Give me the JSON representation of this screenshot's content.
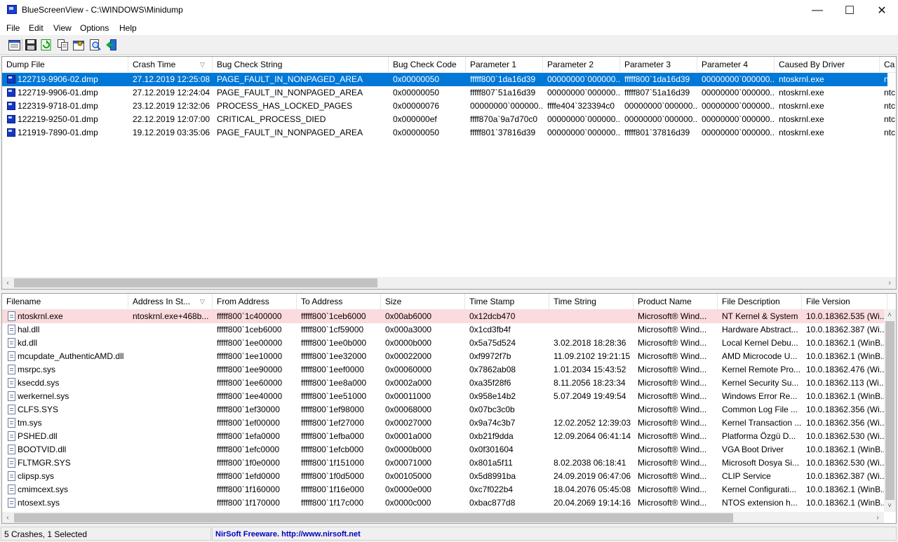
{
  "window": {
    "title": "BlueScreenView  -  C:\\WINDOWS\\Minidump",
    "minimize": "—",
    "maximize": "☐",
    "close": "✕"
  },
  "menu": [
    "File",
    "Edit",
    "View",
    "Options",
    "Help"
  ],
  "toolbar_icons": [
    "properties-icon",
    "save-icon",
    "refresh-icon",
    "copy-icon",
    "advanced-options-icon",
    "find-icon",
    "exit-icon"
  ],
  "crashes": {
    "columns": [
      "Dump File",
      "Crash Time",
      "Bug Check String",
      "Bug Check Code",
      "Parameter 1",
      "Parameter 2",
      "Parameter 3",
      "Parameter 4",
      "Caused By Driver",
      "Ca"
    ],
    "sorted_column": "Crash Time",
    "rows": [
      [
        "122719-9906-02.dmp",
        "27.12.2019 12:25:08",
        "PAGE_FAULT_IN_NONPAGED_AREA",
        "0x00000050",
        "fffff800`1da16d39",
        "00000000`000000...",
        "fffff800`1da16d39",
        "00000000`000000...",
        "ntoskrnl.exe",
        "ntc"
      ],
      [
        "122719-9906-01.dmp",
        "27.12.2019 12:24:04",
        "PAGE_FAULT_IN_NONPAGED_AREA",
        "0x00000050",
        "fffff807`51a16d39",
        "00000000`000000...",
        "fffff807`51a16d39",
        "00000000`000000...",
        "ntoskrnl.exe",
        "ntc"
      ],
      [
        "122319-9718-01.dmp",
        "23.12.2019 12:32:06",
        "PROCESS_HAS_LOCKED_PAGES",
        "0x00000076",
        "00000000`000000...",
        "ffffe404`323394c0",
        "00000000`000000...",
        "00000000`000000...",
        "ntoskrnl.exe",
        "ntc"
      ],
      [
        "122219-9250-01.dmp",
        "22.12.2019 12:07:00",
        "CRITICAL_PROCESS_DIED",
        "0x000000ef",
        "ffff870a`9a7d70c0",
        "00000000`000000...",
        "00000000`000000...",
        "00000000`000000...",
        "ntoskrnl.exe",
        "ntc"
      ],
      [
        "121919-7890-01.dmp",
        "19.12.2019 03:35:06",
        "PAGE_FAULT_IN_NONPAGED_AREA",
        "0x00000050",
        "fffff801`37816d39",
        "00000000`000000...",
        "fffff801`37816d39",
        "00000000`000000...",
        "ntoskrnl.exe",
        "ntc"
      ]
    ],
    "selected_row": 0
  },
  "drivers": {
    "columns": [
      "Filename",
      "Address In St...",
      "From Address",
      "To Address",
      "Size",
      "Time Stamp",
      "Time String",
      "Product Name",
      "File Description",
      "File Version"
    ],
    "sorted_column": "Address In St...",
    "rows": [
      [
        "ntoskrnl.exe",
        "ntoskrnl.exe+468b...",
        "fffff800`1c400000",
        "fffff800`1ceb6000",
        "0x00ab6000",
        "0x12dcb470",
        "",
        "Microsoft® Wind...",
        "NT Kernel & System",
        "10.0.18362.535 (Wi..."
      ],
      [
        "hal.dll",
        "",
        "fffff800`1ceb6000",
        "fffff800`1cf59000",
        "0x000a3000",
        "0x1cd3fb4f",
        "",
        "Microsoft® Wind...",
        "Hardware Abstract...",
        "10.0.18362.387 (Wi..."
      ],
      [
        "kd.dll",
        "",
        "fffff800`1ee00000",
        "fffff800`1ee0b000",
        "0x0000b000",
        "0x5a75d524",
        "3.02.2018 18:28:36",
        "Microsoft® Wind...",
        "Local Kernel Debu...",
        "10.0.18362.1 (WinB..."
      ],
      [
        "mcupdate_AuthenticAMD.dll",
        "",
        "fffff800`1ee10000",
        "fffff800`1ee32000",
        "0x00022000",
        "0xf9972f7b",
        "11.09.2102 19:21:15",
        "Microsoft® Wind...",
        "AMD Microcode U...",
        "10.0.18362.1 (WinB..."
      ],
      [
        "msrpc.sys",
        "",
        "fffff800`1ee90000",
        "fffff800`1eef0000",
        "0x00060000",
        "0x7862ab08",
        "1.01.2034 15:43:52",
        "Microsoft® Wind...",
        "Kernel Remote Pro...",
        "10.0.18362.476 (Wi..."
      ],
      [
        "ksecdd.sys",
        "",
        "fffff800`1ee60000",
        "fffff800`1ee8a000",
        "0x0002a000",
        "0xa35f28f6",
        "8.11.2056 18:23:34",
        "Microsoft® Wind...",
        "Kernel Security Su...",
        "10.0.18362.113 (Wi..."
      ],
      [
        "werkernel.sys",
        "",
        "fffff800`1ee40000",
        "fffff800`1ee51000",
        "0x00011000",
        "0x958e14b2",
        "5.07.2049 19:49:54",
        "Microsoft® Wind...",
        "Windows Error Re...",
        "10.0.18362.1 (WinB..."
      ],
      [
        "CLFS.SYS",
        "",
        "fffff800`1ef30000",
        "fffff800`1ef98000",
        "0x00068000",
        "0x07bc3c0b",
        "",
        "Microsoft® Wind...",
        "Common Log File ...",
        "10.0.18362.356 (Wi..."
      ],
      [
        "tm.sys",
        "",
        "fffff800`1ef00000",
        "fffff800`1ef27000",
        "0x00027000",
        "0x9a74c3b7",
        "12.02.2052 12:39:03",
        "Microsoft® Wind...",
        "Kernel Transaction ...",
        "10.0.18362.356 (Wi..."
      ],
      [
        "PSHED.dll",
        "",
        "fffff800`1efa0000",
        "fffff800`1efba000",
        "0x0001a000",
        "0xb21f9dda",
        "12.09.2064 06:41:14",
        "Microsoft® Wind...",
        "Platforma Özgü D...",
        "10.0.18362.530 (Wi..."
      ],
      [
        "BOOTVID.dll",
        "",
        "fffff800`1efc0000",
        "fffff800`1efcb000",
        "0x0000b000",
        "0x0f301604",
        "",
        "Microsoft® Wind...",
        "VGA Boot Driver",
        "10.0.18362.1 (WinB..."
      ],
      [
        "FLTMGR.SYS",
        "",
        "fffff800`1f0e0000",
        "fffff800`1f151000",
        "0x00071000",
        "0x801a5f11",
        "8.02.2038 06:18:41",
        "Microsoft® Wind...",
        "Microsoft Dosya Si...",
        "10.0.18362.530 (Wi..."
      ],
      [
        "clipsp.sys",
        "",
        "fffff800`1efd0000",
        "fffff800`1f0d5000",
        "0x00105000",
        "0x5d8991ba",
        "24.09.2019 06:47:06",
        "Microsoft® Wind...",
        "CLIP Service",
        "10.0.18362.387 (Wi..."
      ],
      [
        "cmimcext.sys",
        "",
        "fffff800`1f160000",
        "fffff800`1f16e000",
        "0x0000e000",
        "0xc7f022b4",
        "18.04.2076 05:45:08",
        "Microsoft® Wind...",
        "Kernel Configurati...",
        "10.0.18362.1 (WinB..."
      ],
      [
        "ntosext.sys",
        "",
        "fffff800`1f170000",
        "fffff800`1f17c000",
        "0x0000c000",
        "0xbac877d8",
        "20.04.2069 19:14:16",
        "Microsoft® Wind...",
        "NTOS extension h...",
        "10.0.18362.1 (WinB..."
      ]
    ],
    "highlighted_row": 0
  },
  "status": {
    "crashes": "5 Crashes, 1 Selected",
    "nirsoft": "NirSoft Freeware.  http://www.nirsoft.net"
  },
  "colors": {
    "selection": "#0078d7",
    "highlight": "#fbdbdd",
    "link": "#0000c0"
  }
}
